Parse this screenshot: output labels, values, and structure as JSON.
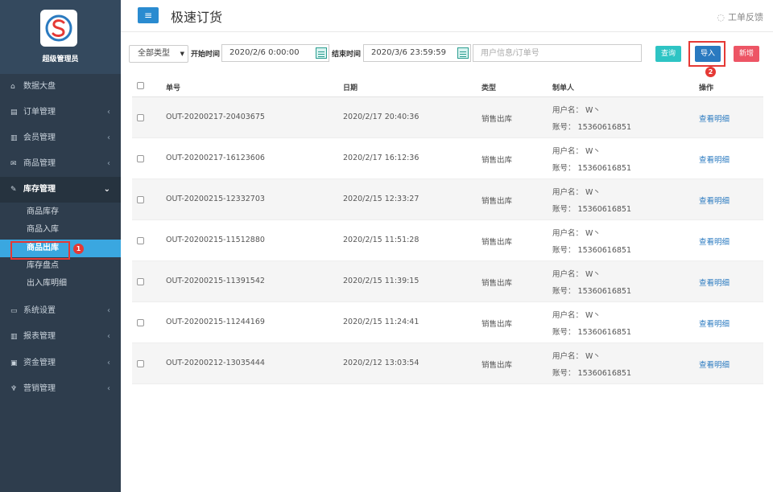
{
  "sidebar": {
    "role": "超级管理员",
    "items": [
      {
        "label": "数据大盘",
        "icon": "home-icon",
        "glyph": "⌂"
      },
      {
        "label": "订单管理",
        "icon": "order-icon",
        "glyph": "▤"
      },
      {
        "label": "会员管理",
        "icon": "bar-chart-icon",
        "glyph": "▥"
      },
      {
        "label": "商品管理",
        "icon": "envelope-icon",
        "glyph": "✉"
      },
      {
        "label": "库存管理",
        "icon": "edit-icon",
        "glyph": "✎"
      },
      {
        "label": "系统设置",
        "icon": "monitor-icon",
        "glyph": "▭"
      },
      {
        "label": "报表管理",
        "icon": "report-icon",
        "glyph": "▥"
      },
      {
        "label": "资金管理",
        "icon": "money-icon",
        "glyph": "▣"
      },
      {
        "label": "营销管理",
        "icon": "marketing-icon",
        "glyph": "♆"
      }
    ],
    "subitems": [
      "商品库存",
      "商品入库",
      "商品出库",
      "库存盘点",
      "出入库明细"
    ],
    "markers": {
      "one": "1",
      "two": "2"
    }
  },
  "header": {
    "title": "极速订货",
    "feedback": "工单反馈",
    "menu_glyph": "≡"
  },
  "toolbar": {
    "type_select": "全部类型",
    "start_label": "开始时间",
    "start_value": "2020/2/6 0:00:00",
    "end_label": "结束时间",
    "end_value": "2020/3/6 23:59:59",
    "search_placeholder": "用户信息/订单号",
    "query_label": "查询",
    "import_label": "导入",
    "new_label": "新增"
  },
  "table": {
    "headers": {
      "order": "单号",
      "date": "日期",
      "type": "类型",
      "maker": "制单人",
      "action": "操作"
    },
    "rows": [
      {
        "order": "OUT-20200217-20403675",
        "date": "2020/2/17 20:40:36",
        "type": "销售出库",
        "user": "用户名：  W丶",
        "account": "账号：  15360616851",
        "action": "查看明细"
      },
      {
        "order": "OUT-20200217-16123606",
        "date": "2020/2/17 16:12:36",
        "type": "销售出库",
        "user": "用户名：  W丶",
        "account": "账号：  15360616851",
        "action": "查看明细"
      },
      {
        "order": "OUT-20200215-12332703",
        "date": "2020/2/15 12:33:27",
        "type": "销售出库",
        "user": "用户名：  W丶",
        "account": "账号：  15360616851",
        "action": "查看明细"
      },
      {
        "order": "OUT-20200215-11512880",
        "date": "2020/2/15 11:51:28",
        "type": "销售出库",
        "user": "用户名：  W丶",
        "account": "账号：  15360616851",
        "action": "查看明细"
      },
      {
        "order": "OUT-20200215-11391542",
        "date": "2020/2/15 11:39:15",
        "type": "销售出库",
        "user": "用户名：  W丶",
        "account": "账号：  15360616851",
        "action": "查看明细"
      },
      {
        "order": "OUT-20200215-11244169",
        "date": "2020/2/15 11:24:41",
        "type": "销售出库",
        "user": "用户名：  W丶",
        "account": "账号：  15360616851",
        "action": "查看明细"
      },
      {
        "order": "OUT-20200212-13035444",
        "date": "2020/2/12 13:03:54",
        "type": "销售出库",
        "user": "用户名：  W丶",
        "account": "账号：  15360616851",
        "action": "查看明细"
      }
    ]
  }
}
